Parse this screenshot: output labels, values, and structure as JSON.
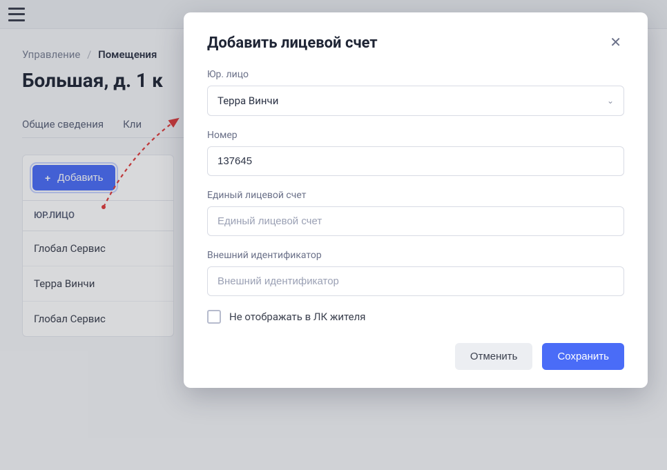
{
  "breadcrumb": {
    "root": "Управление",
    "current": "Помещения"
  },
  "page_title": "Большая, д. 1 к",
  "tabs": {
    "general": "Общие сведения",
    "clients": "Кли"
  },
  "sidebar": {
    "add_label": "Добавить",
    "column_header": "ЮР.ЛИЦО",
    "items": [
      {
        "label": "Глобал Сервис"
      },
      {
        "label": "Терра Винчи"
      },
      {
        "label": "Глобал Сервис"
      }
    ]
  },
  "modal": {
    "title": "Добавить лицевой счет",
    "fields": {
      "entity": {
        "label": "Юр. лицо",
        "value": "Терра Винчи"
      },
      "number": {
        "label": "Номер",
        "value": "137645"
      },
      "unified": {
        "label": "Единый лицевой счет",
        "placeholder": "Единый лицевой счет"
      },
      "external_id": {
        "label": "Внешний идентификатор",
        "placeholder": "Внешний идентификатор"
      }
    },
    "checkbox_label": "Не отображать в ЛК жителя",
    "cancel_label": "Отменить",
    "save_label": "Сохранить"
  },
  "colors": {
    "primary": "#4a6cf7",
    "annotation": "#e03b3b"
  }
}
